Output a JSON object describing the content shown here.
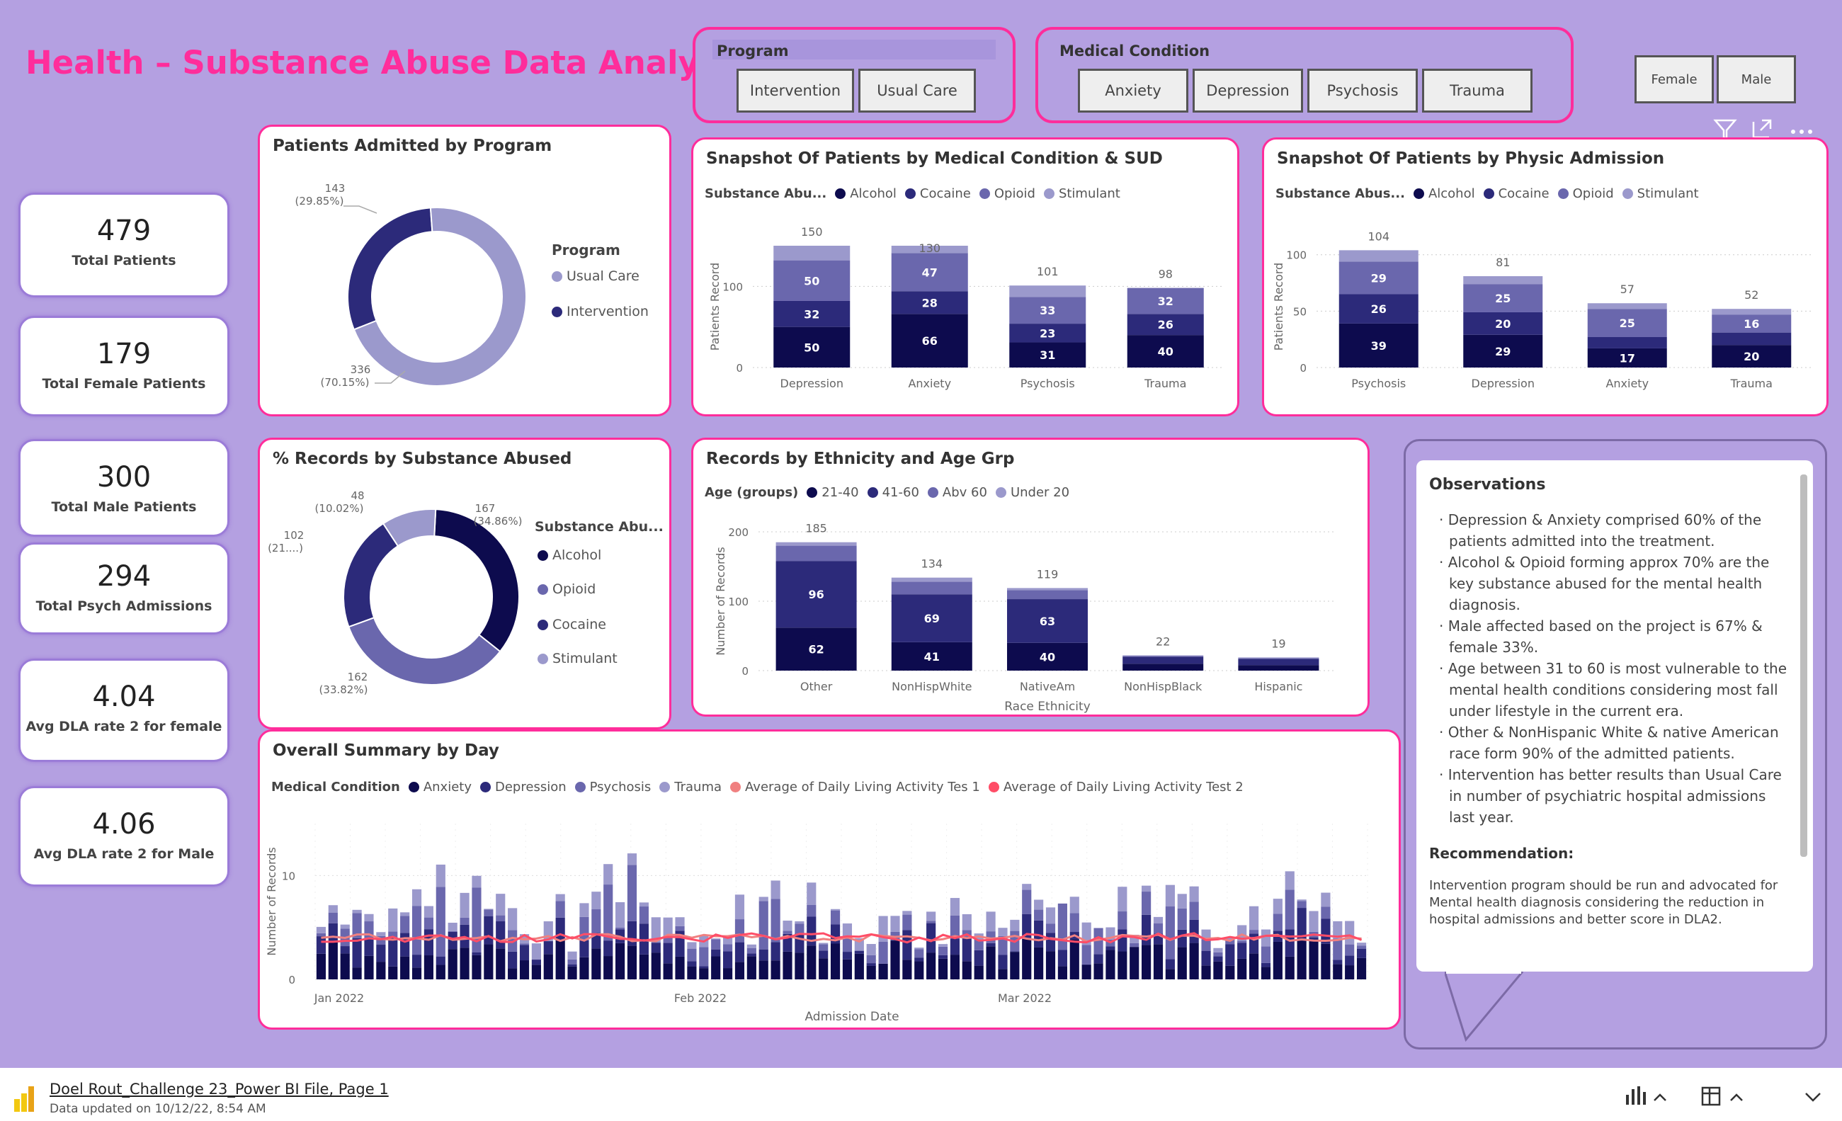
{
  "colors": {
    "navy": "#0d0b4e",
    "dark": "#2c2a7a",
    "mid": "#6a67ad",
    "light": "#9b99cc",
    "pink": "#ff2d9b",
    "bg": "#b4a0e1",
    "red": "#ff4d67"
  },
  "header": {
    "title": "Health – Substance Abuse Data Analysis"
  },
  "program_slicer": {
    "label": "Program",
    "buttons": [
      "Intervention",
      "Usual Care"
    ]
  },
  "condition_slicer": {
    "label": "Medical Condition",
    "buttons": [
      "Anxiety",
      "Depression",
      "Psychosis",
      "Trauma"
    ]
  },
  "gender_slicer": {
    "buttons": [
      "Female",
      "Male"
    ]
  },
  "toolbar_icons": [
    "filter-icon",
    "focus-mode-icon",
    "more-options-icon"
  ],
  "kpis": [
    {
      "value": "479",
      "label": "Total Patients"
    },
    {
      "value": "179",
      "label": "Total Female Patients"
    },
    {
      "value": "300",
      "label": "Total Male Patients"
    },
    {
      "value": "294",
      "label": "Total Psych Admissions"
    },
    {
      "value": "4.04",
      "label": "Avg DLA rate 2 for female"
    },
    {
      "value": "4.06",
      "label": "Avg DLA rate 2 for Male"
    }
  ],
  "donut_program": {
    "title": "Patients Admitted by Program",
    "legend_title": "Program",
    "legend": [
      "Usual Care",
      "Intervention"
    ],
    "labels": [
      "143",
      "(29.85%)",
      "336",
      "(70.15%)"
    ]
  },
  "donut_substance": {
    "title": "% Records by Substance Abused",
    "legend_title": "Substance Abu...",
    "legend": [
      "Alcohol",
      "Opioid",
      "Cocaine",
      "Stimulant"
    ],
    "labels": [
      "48",
      "(10.02%)",
      "102",
      "(21....)",
      "167",
      "(34.86%)",
      "162",
      "(33.82%)"
    ]
  },
  "chart_cond": {
    "title": "Snapshot Of Patients by Medical Condition & SUD",
    "legend_title": "Substance Abu...",
    "legend": [
      "Alcohol",
      "Cocaine",
      "Opioid",
      "Stimulant"
    ],
    "ylabel": "Patients Record",
    "yticks": [
      "0",
      "100"
    ]
  },
  "chart_physic": {
    "title": "Snapshot Of Patients by Physic Admission",
    "legend_title": "Substance Abus...",
    "legend": [
      "Alcohol",
      "Cocaine",
      "Opioid",
      "Stimulant"
    ],
    "ylabel": "Patients Record",
    "yticks": [
      "0",
      "50",
      "100"
    ]
  },
  "chart_eth": {
    "title": "Records by Ethnicity and Age Grp",
    "legend_title": "Age (groups)",
    "legend": [
      "21-40",
      "41-60",
      "Abv 60",
      "Under 20"
    ],
    "ylabel": "Number of Records",
    "xlabel": "Race Ethnicity",
    "yticks": [
      "0",
      "100",
      "200"
    ]
  },
  "chart_day": {
    "title": "Overall Summary by Day",
    "legend_title": "Medical Condition",
    "legend": [
      "Anxiety",
      "Depression",
      "Psychosis",
      "Trauma",
      "Average of Daily Living Activity Tes 1",
      "Average of Daily Living Activity Test 2"
    ],
    "ylabel": "Number of Records",
    "xlabel": "Admission Date",
    "yticks": [
      "0",
      "10"
    ],
    "xticks": [
      "Jan 2022",
      "Feb 2022",
      "Mar 2022"
    ]
  },
  "chart_data": [
    {
      "type": "pie",
      "title": "Patients Admitted by Program",
      "categories": [
        "Usual Care",
        "Intervention"
      ],
      "values": [
        336,
        143
      ],
      "percent": [
        70.15,
        29.85
      ]
    },
    {
      "type": "pie",
      "title": "% Records by Substance Abused",
      "categories": [
        "Alcohol",
        "Opioid",
        "Cocaine",
        "Stimulant"
      ],
      "values": [
        167,
        162,
        102,
        48
      ],
      "percent": [
        34.86,
        33.82,
        21.3,
        10.02
      ]
    },
    {
      "type": "bar",
      "title": "Snapshot Of Patients by Medical Condition & SUD",
      "categories": [
        "Depression",
        "Anxiety",
        "Psychosis",
        "Trauma"
      ],
      "totals": [
        150,
        130,
        101,
        98
      ],
      "ylabel": "Patients Record",
      "ylim": [
        0,
        150
      ],
      "series": [
        {
          "name": "Alcohol",
          "values": [
            50,
            66,
            31,
            40
          ]
        },
        {
          "name": "Cocaine",
          "values": [
            32,
            28,
            23,
            26
          ]
        },
        {
          "name": "Opioid",
          "values": [
            50,
            47,
            33,
            32
          ]
        },
        {
          "name": "Stimulant",
          "values": [
            18,
            9,
            14,
            0
          ]
        }
      ]
    },
    {
      "type": "bar",
      "title": "Snapshot Of Patients by Physic Admission",
      "categories": [
        "Psychosis",
        "Depression",
        "Anxiety",
        "Trauma"
      ],
      "totals": [
        104,
        81,
        57,
        52
      ],
      "ylabel": "Patients Record",
      "ylim": [
        0,
        105
      ],
      "series": [
        {
          "name": "Alcohol",
          "values": [
            39,
            29,
            17,
            20
          ]
        },
        {
          "name": "Cocaine",
          "values": [
            26,
            20,
            10,
            11
          ]
        },
        {
          "name": "Opioid",
          "values": [
            29,
            25,
            25,
            16
          ]
        },
        {
          "name": "Stimulant",
          "values": [
            10,
            7,
            5,
            5
          ]
        }
      ]
    },
    {
      "type": "bar",
      "title": "Records by Ethnicity and Age Grp",
      "categories": [
        "Other",
        "NonHispWhite",
        "NativeAm",
        "NonHispBlack",
        "Hispanic"
      ],
      "totals": [
        185,
        134,
        119,
        22,
        19
      ],
      "xlabel": "Race Ethnicity",
      "ylabel": "Number of Records",
      "ylim": [
        0,
        200
      ],
      "series": [
        {
          "name": "21-40",
          "values": [
            62,
            41,
            40,
            10,
            8
          ]
        },
        {
          "name": "41-60",
          "values": [
            96,
            69,
            63,
            10,
            9
          ]
        },
        {
          "name": "Abv 60",
          "values": [
            22,
            18,
            13,
            1,
            1
          ]
        },
        {
          "name": "Under 20",
          "values": [
            5,
            6,
            3,
            1,
            1
          ]
        }
      ]
    },
    {
      "type": "bar",
      "title": "Overall Summary by Day",
      "xlabel": "Admission Date",
      "ylabel": "Number of Records",
      "x_range": [
        "Jan 2022",
        "Mar 2022"
      ],
      "ylim": [
        0,
        15
      ],
      "note": "stacked daily counts (~0–15) with two DLA average lines (~4)"
    }
  ],
  "observations": {
    "title": "Observations",
    "items": [
      "Depression & Anxiety comprised 60% of the patients admitted into the treatment.",
      "Alcohol & Opioid forming approx 70% are the key substance abused for the mental health diagnosis.",
      "Male affected based on the project is 67% & female 33%.",
      "Age between 31 to 60 is most vulnerable to the mental health conditions considering most fall under lifestyle in the current era.",
      "Other & NonHispanic White & native American race form 90% of the admitted patients.",
      "Intervention has better results than Usual Care in number of psychiatric hospital admissions last year."
    ],
    "rec_title": "Recommendation:",
    "rec_text": "Intervention program should be run and advocated for Mental health diagnosis considering the reduction in hospital admissions and better score in DLA2."
  },
  "footer": {
    "file_title": "Doel Rout_Challenge 23_Power BI File, Page 1",
    "updated": "Data updated on 10/12/22, 8:54 AM"
  }
}
